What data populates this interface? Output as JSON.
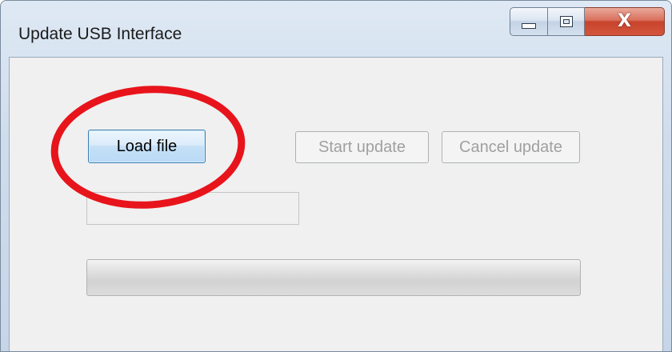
{
  "window": {
    "title": "Update USB Interface",
    "close_glyph": "X"
  },
  "buttons": {
    "load_file": "Load file",
    "start_update": "Start update",
    "cancel_update": "Cancel update"
  },
  "file_path": {
    "value": ""
  },
  "progress": {
    "value": 0
  },
  "colors": {
    "annotation_circle": "#e8141b",
    "load_button_border": "#3c7fb1",
    "disabled_text": "#a0a0a0"
  }
}
